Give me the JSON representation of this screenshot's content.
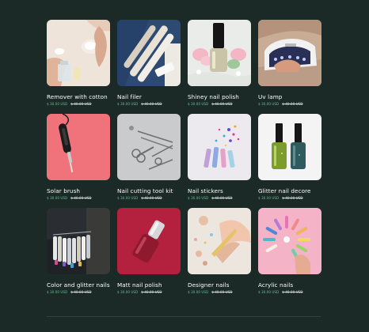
{
  "products": [
    {
      "title": "Remover with cotton",
      "price": "$ 30.00 USD",
      "old_price": "$ 40.00 USD",
      "icon": "remover-cotton-image"
    },
    {
      "title": "Nail filer",
      "price": "$ 30.00 USD",
      "old_price": "$ 40.00 USD",
      "icon": "nail-filer-image"
    },
    {
      "title": "Shiney nail polish",
      "price": "$ 30.00 USD",
      "old_price": "$ 40.00 USD",
      "icon": "nail-polish-image"
    },
    {
      "title": "Uv lamp",
      "price": "$ 30.00 USD",
      "old_price": "$ 40.00 USD",
      "icon": "uv-lamp-image"
    },
    {
      "title": "Solar brush",
      "price": "$ 30.00 USD",
      "old_price": "$ 40.00 USD",
      "icon": "solar-brush-image"
    },
    {
      "title": "Nail cutting tool kit",
      "price": "$ 30.00 USD",
      "old_price": "$ 40.00 USD",
      "icon": "tool-kit-image"
    },
    {
      "title": "Nail stickers",
      "price": "$ 30.00 USD",
      "old_price": "$ 40.00 USD",
      "icon": "nail-stickers-image"
    },
    {
      "title": "Glitter nail decore",
      "price": "$ 30.00 USD",
      "old_price": "$ 40.00 USD",
      "icon": "glitter-polish-image"
    },
    {
      "title": "Color and glitter nails",
      "price": "$ 30.00 USD",
      "old_price": "$ 40.00 USD",
      "icon": "color-nails-image"
    },
    {
      "title": "Matt nail polish",
      "price": "$ 30.00 USD",
      "old_price": "$ 40.00 USD",
      "icon": "matt-polish-image"
    },
    {
      "title": "Designer nails",
      "price": "$ 30.00 USD",
      "old_price": "$ 40.00 USD",
      "icon": "designer-nails-image"
    },
    {
      "title": "Acrylic nails",
      "price": "$ 30.00 USD",
      "old_price": "$ 40.00 USD",
      "icon": "acrylic-nails-image"
    }
  ],
  "colors": {
    "background": "#1b2a26",
    "price": "#6ab894",
    "text": "#ffffff"
  }
}
